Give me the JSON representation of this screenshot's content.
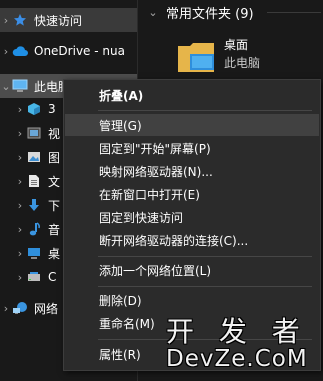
{
  "nav": {
    "items": [
      {
        "label": "快速访问",
        "icon": "star-icon",
        "expand": "›"
      },
      {
        "label": "OneDrive - nua",
        "icon": "cloud-icon",
        "expand": "›"
      },
      {
        "label": "此电脑",
        "icon": "pc-icon",
        "expand": "⌄"
      },
      {
        "label": "3",
        "icon": "3d-objects-icon",
        "expand": "›"
      },
      {
        "label": "视",
        "icon": "videos-icon",
        "expand": "›"
      },
      {
        "label": "图",
        "icon": "pictures-icon",
        "expand": "›"
      },
      {
        "label": "文",
        "icon": "documents-icon",
        "expand": "›"
      },
      {
        "label": "下",
        "icon": "downloads-icon",
        "expand": "›"
      },
      {
        "label": "音",
        "icon": "music-icon",
        "expand": "›"
      },
      {
        "label": "桌",
        "icon": "desktop-icon",
        "expand": "›"
      },
      {
        "label": "C",
        "icon": "drive-icon",
        "expand": "›"
      },
      {
        "label": "网络",
        "icon": "network-icon",
        "expand": "›"
      }
    ]
  },
  "content": {
    "group_title": "常用文件夹 (9)",
    "group_chevron": "⌄",
    "tile": {
      "name": "桌面",
      "location": "此电脑",
      "icon": "desktop-folder-icon"
    }
  },
  "menu": {
    "items": [
      {
        "label": "折叠(A)",
        "bold": true
      },
      {
        "label": "管理(G)",
        "hover": true
      },
      {
        "label": "固定到\"开始\"屏幕(P)"
      },
      {
        "label": "映射网络驱动器(N)..."
      },
      {
        "label": "在新窗口中打开(E)"
      },
      {
        "label": "固定到快速访问"
      },
      {
        "label": "断开网络驱动器的连接(C)..."
      },
      {
        "label": "添加一个网络位置(L)"
      },
      {
        "label": "删除(D)"
      },
      {
        "label": "重命名(M)"
      },
      {
        "label": "属性(R)"
      }
    ]
  },
  "watermark": {
    "line1": "开 发 者",
    "line2": "DevZe.CoM"
  }
}
